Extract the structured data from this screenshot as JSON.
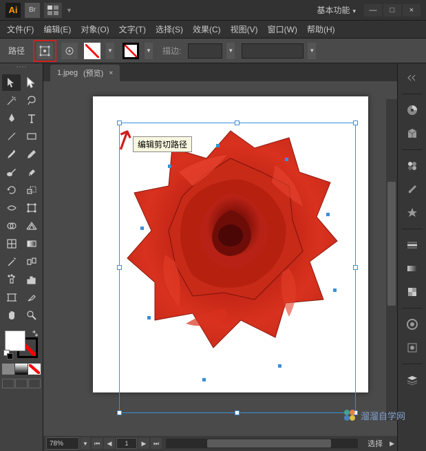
{
  "app": {
    "logo": "Ai",
    "bridge": "Br",
    "workspace": "基本功能"
  },
  "winbtns": {
    "min": "—",
    "max": "□",
    "close": "×"
  },
  "menu": {
    "file": "文件(F)",
    "edit": "编辑(E)",
    "object": "对象(O)",
    "type": "文字(T)",
    "select": "选择(S)",
    "effect": "效果(C)",
    "view": "视图(V)",
    "window": "窗口(W)",
    "help": "帮助(H)"
  },
  "control": {
    "label": "路径",
    "stroke_label": "描边:",
    "tooltip": "编辑剪切路径"
  },
  "tab": {
    "name": "1.jpeg",
    "suffix": "(预览)",
    "close": "×"
  },
  "zoom": {
    "value": "78%",
    "page": "1"
  },
  "status": {
    "selection": "选择"
  },
  "watermark": {
    "text": "溜溜自学网"
  }
}
